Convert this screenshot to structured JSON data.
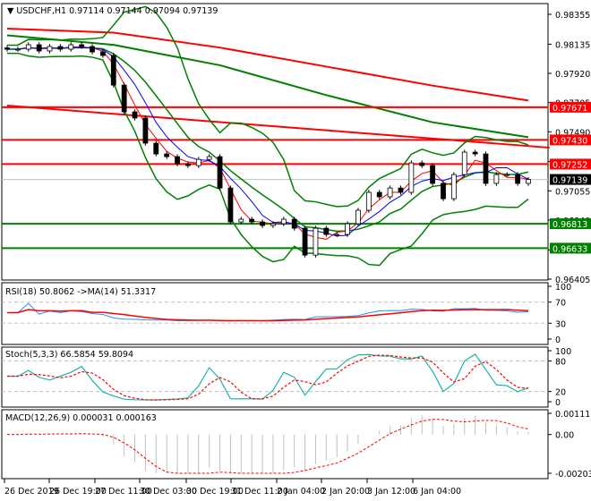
{
  "header": {
    "symbol": "USDCHF,H1",
    "open": "0.97114",
    "high": "0.97144",
    "low": "0.97094",
    "close": "0.97139"
  },
  "colors": {
    "bull": "#000000",
    "bear": "#000000",
    "bands": "#008000",
    "ma_fast": "#0000ff",
    "ma_slow": "#ff0000",
    "level_resist": "#ff0000",
    "level_support": "#008000",
    "rsi": "#1e90ff",
    "stoch_main": "#20b2aa",
    "signal": "#ff0000",
    "macd_hist": "#c0c0c0"
  },
  "chart_data": [
    {
      "type": "candlestick",
      "title": "USDCHF,H1",
      "ylim": [
        0.96405,
        0.98355
      ],
      "y_ticks": [
        "0.98355",
        "0.98135",
        "0.97920",
        "0.97705",
        "0.97490",
        "0.97270",
        "0.97055",
        "0.96840",
        "0.96620",
        "0.96405"
      ],
      "x_ticks": [
        "26 Dec 2019",
        "26 Dec 19:00",
        "27 Dec 11:00",
        "30 Dec 03:00",
        "30 Dec 19:00",
        "31 Dec 11:00",
        "2 Jan 04:00",
        "2 Jan 20:00",
        "3 Jan 12:00",
        "6 Jan 04:00"
      ],
      "close": [
        0.98098,
        0.98098,
        0.98131,
        0.98085,
        0.98118,
        0.98098,
        0.98131,
        0.98118,
        0.98078,
        0.98052,
        0.97834,
        0.97637,
        0.97591,
        0.97406,
        0.97327,
        0.97307,
        0.97254,
        0.97241,
        0.97287,
        0.97307,
        0.97076,
        0.96826,
        0.96846,
        0.96826,
        0.968,
        0.96813,
        0.96846,
        0.9678,
        0.96582,
        0.9678,
        0.96734,
        0.96734,
        0.96813,
        0.96912,
        0.97044,
        0.97011,
        0.97076,
        0.97044,
        0.97261,
        0.97241,
        0.9711,
        0.96997,
        0.97175,
        0.9734,
        0.97327,
        0.9711,
        0.97175,
        0.97175,
        0.9711,
        0.97139
      ],
      "long_ma_red": [
        [
          0,
          0.9825
        ],
        [
          10,
          0.9822
        ],
        [
          20,
          0.9811
        ],
        [
          30,
          0.9797
        ],
        [
          40,
          0.9783
        ],
        [
          49,
          0.9772
        ]
      ],
      "long_ma_green": [
        [
          0,
          0.982
        ],
        [
          10,
          0.9813
        ],
        [
          20,
          0.9798
        ],
        [
          30,
          0.9776
        ],
        [
          40,
          0.9756
        ],
        [
          49,
          0.9745
        ]
      ],
      "trendline": [
        [
          0,
          0.97683
        ],
        [
          51,
          0.97373
        ]
      ],
      "levels": [
        {
          "value": "0.97671",
          "kind": "resistance"
        },
        {
          "value": "0.97430",
          "kind": "resistance"
        },
        {
          "value": "0.97252",
          "kind": "resistance"
        },
        {
          "value": "0.96813",
          "kind": "support"
        },
        {
          "value": "0.96633",
          "kind": "support"
        }
      ],
      "current_price": "0.97139"
    },
    {
      "type": "line",
      "title": "RSI(18) 50.8062  ->MA(14) 51.3317",
      "ylim": [
        0,
        100
      ],
      "y_ticks": [
        "100",
        "70",
        "30",
        "0"
      ],
      "levels": [
        70,
        30
      ]
    },
    {
      "type": "line",
      "title": "Stoch(5,3,3) 66.5854 59.8094",
      "ylim": [
        0,
        100
      ],
      "y_ticks": [
        "100",
        "80",
        "20",
        "0"
      ],
      "levels": [
        80,
        20
      ]
    },
    {
      "type": "bar",
      "title": "MACD(12,26,9) 0.000031 0.000163",
      "ylim": [
        -0.002033,
        0.00111
      ],
      "y_ticks": [
        "0.00111",
        "0.00",
        "-0.002033"
      ]
    }
  ]
}
